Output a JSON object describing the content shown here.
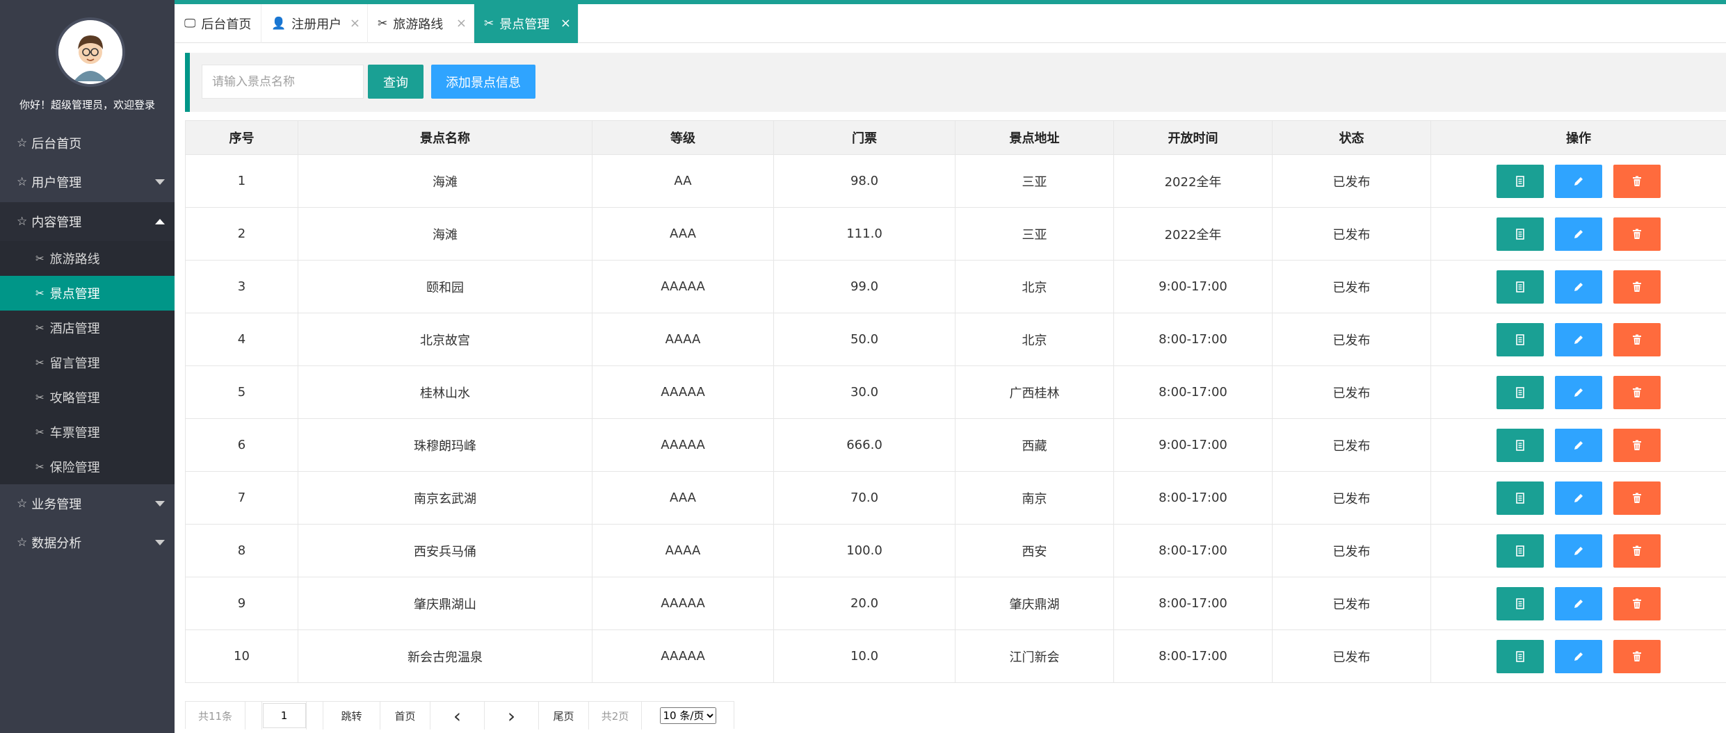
{
  "sidebar": {
    "greeting": "你好！超级管理员，欢迎登录",
    "menu": [
      {
        "label": "后台首页"
      },
      {
        "label": "用户管理"
      },
      {
        "label": "内容管理"
      },
      {
        "label": "业务管理"
      },
      {
        "label": "数据分析"
      }
    ],
    "submenu": [
      {
        "label": "旅游路线"
      },
      {
        "label": "景点管理"
      },
      {
        "label": "酒店管理"
      },
      {
        "label": "留言管理"
      },
      {
        "label": "攻略管理"
      },
      {
        "label": "车票管理"
      },
      {
        "label": "保险管理"
      }
    ]
  },
  "tabs": [
    {
      "label": "后台首页",
      "icon": "monitor-icon"
    },
    {
      "label": "注册用户",
      "icon": "user-icon"
    },
    {
      "label": "旅游路线",
      "icon": "tools-icon"
    },
    {
      "label": "景点管理",
      "icon": "tools-icon"
    }
  ],
  "toolbar": {
    "search_placeholder": "请输入景点名称",
    "query_label": "查询",
    "add_label": "添加景点信息"
  },
  "table": {
    "headers": [
      "序号",
      "景点名称",
      "等级",
      "门票",
      "景点地址",
      "开放时间",
      "状态",
      "操作"
    ],
    "rows": [
      [
        "1",
        "海滩",
        "AA",
        "98.0",
        "三亚",
        "2022全年",
        "已发布"
      ],
      [
        "2",
        "海滩",
        "AAA",
        "111.0",
        "三亚",
        "2022全年",
        "已发布"
      ],
      [
        "3",
        "颐和园",
        "AAAAA",
        "99.0",
        "北京",
        "9:00-17:00",
        "已发布"
      ],
      [
        "4",
        "北京故宫",
        "AAAA",
        "50.0",
        "北京",
        "8:00-17:00",
        "已发布"
      ],
      [
        "5",
        "桂林山水",
        "AAAAA",
        "30.0",
        "广西桂林",
        "8:00-17:00",
        "已发布"
      ],
      [
        "6",
        "珠穆朗玛峰",
        "AAAAA",
        "666.0",
        "西藏",
        "9:00-17:00",
        "已发布"
      ],
      [
        "7",
        "南京玄武湖",
        "AAA",
        "70.0",
        "南京",
        "8:00-17:00",
        "已发布"
      ],
      [
        "8",
        "西安兵马俑",
        "AAAA",
        "100.0",
        "西安",
        "8:00-17:00",
        "已发布"
      ],
      [
        "9",
        "肇庆鼎湖山",
        "AAAAA",
        "20.0",
        "肇庆鼎湖",
        "8:00-17:00",
        "已发布"
      ],
      [
        "10",
        "新会古兜温泉",
        "AAAAA",
        "10.0",
        "江门新会",
        "8:00-17:00",
        "已发布"
      ]
    ]
  },
  "pager": {
    "total": "共11条",
    "current_page": "1",
    "jump_label": "跳转",
    "first_label": "首页",
    "prev_symbol": "‹",
    "next_symbol": "›",
    "last_label": "尾页",
    "pages": "共2页",
    "page_size": "10 条/页"
  },
  "colors": {
    "accent": "#009688",
    "blue": "#2fa4ff",
    "orange": "#ff6b3d",
    "sidebar": "#393d49"
  }
}
